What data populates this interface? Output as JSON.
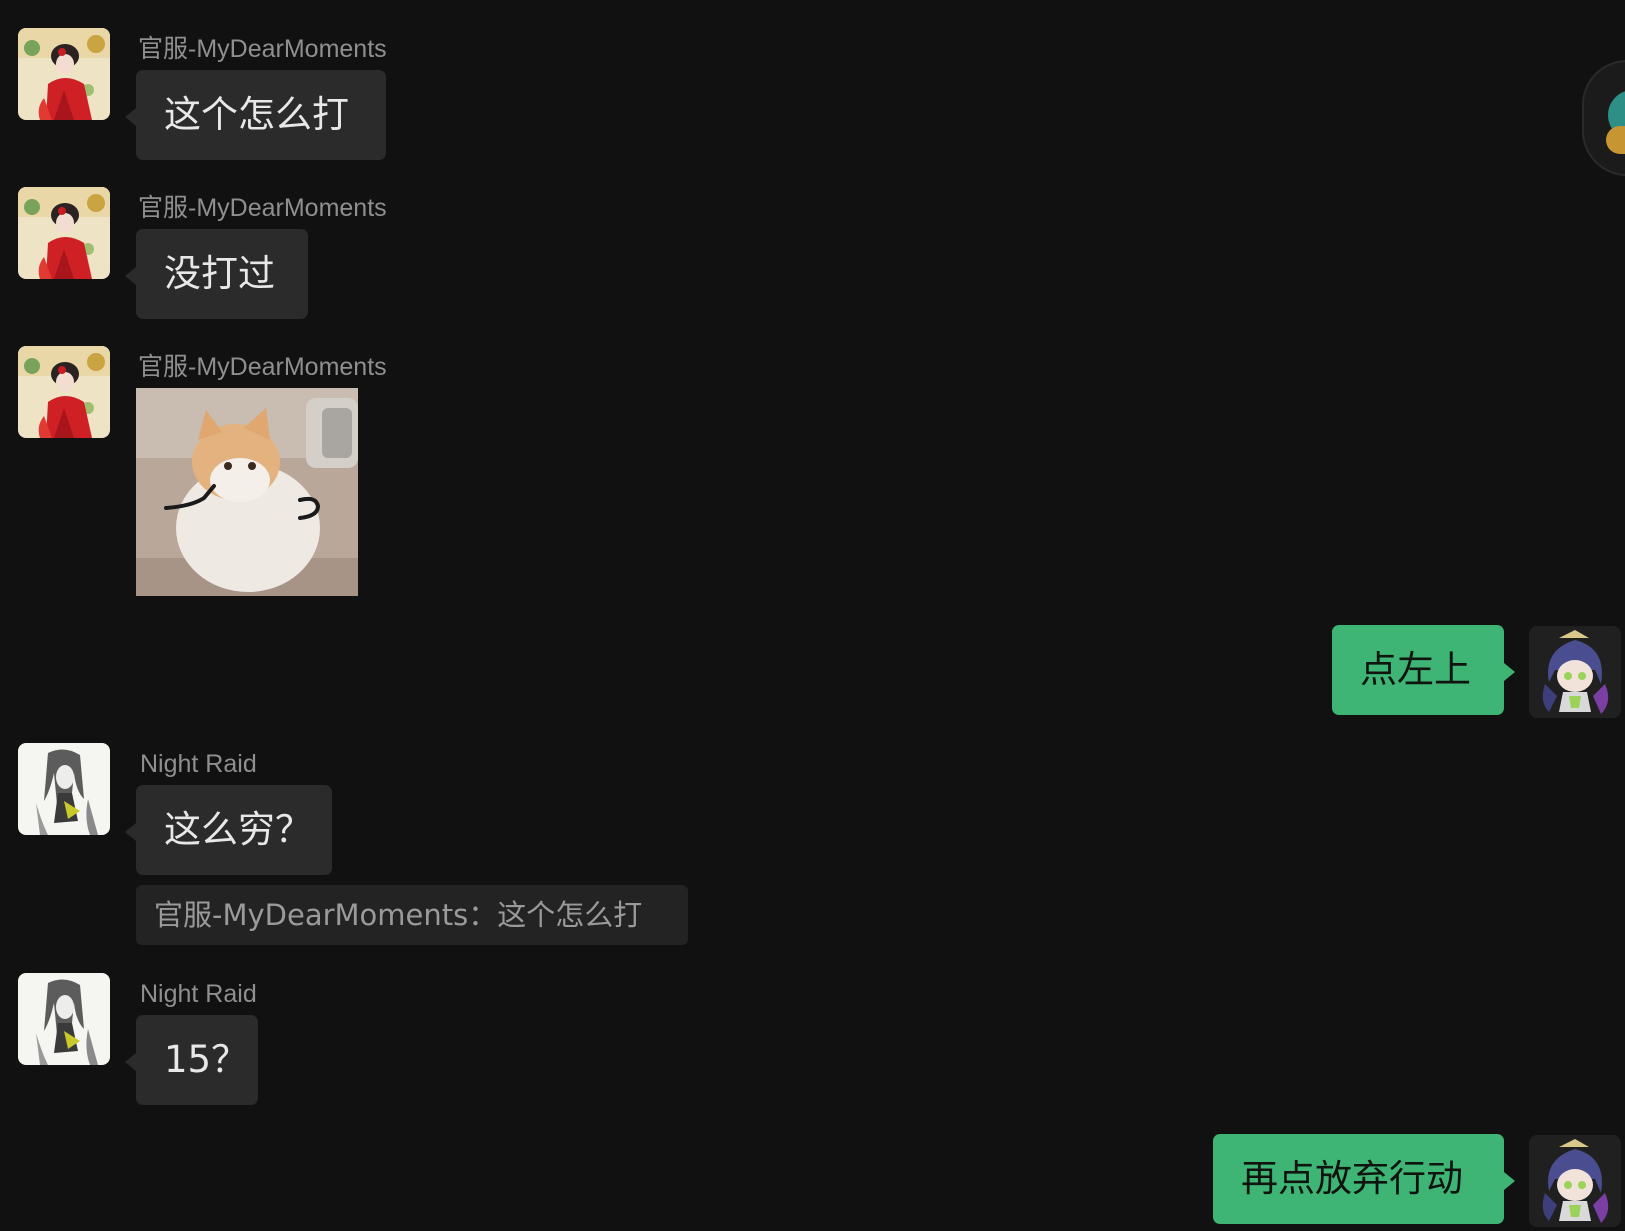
{
  "messages": [
    {
      "sender": "官服-MyDearMoments",
      "text": "这个怎么打"
    },
    {
      "sender": "官服-MyDearMoments",
      "text": "没打过"
    },
    {
      "sender": "官服-MyDearMoments",
      "sticker": "cat-sticker"
    },
    {
      "text": "点左上"
    },
    {
      "sender": "Night Raid",
      "text": "这么穷？",
      "quote": "官服-MyDearMoments：这个怎么打"
    },
    {
      "sender": "Night Raid",
      "text": "15？"
    },
    {
      "text": "再点放弃行动"
    }
  ],
  "colors": {
    "background": "#111111",
    "incoming_bubble": "#2b2b2b",
    "outgoing_bubble": "#3eb575",
    "sender_name": "#8f8f8f"
  },
  "icons": {
    "avatar_mydearmoments": "red-dress-anime-avatar",
    "avatar_nightraid": "sketch-anime-avatar",
    "avatar_self": "purple-chibi-avatar",
    "floating_button": "floating-ball-icon"
  }
}
